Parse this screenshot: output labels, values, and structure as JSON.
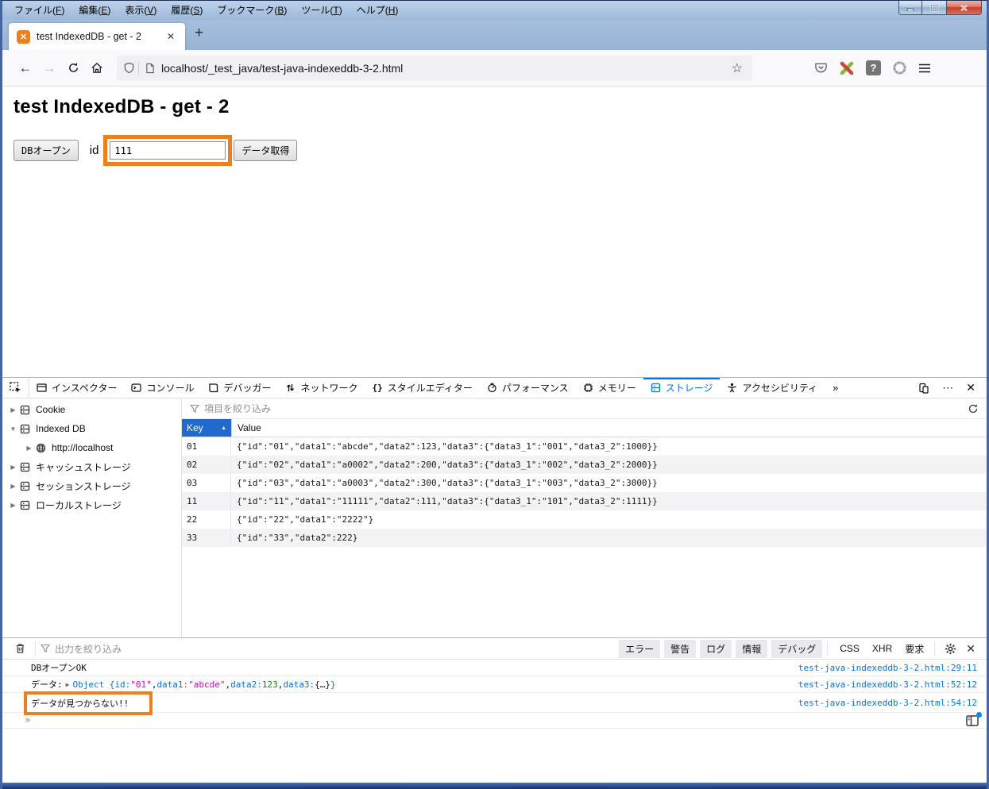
{
  "window": {
    "menu": [
      "ファイル(F)",
      "編集(E)",
      "表示(V)",
      "履歴(S)",
      "ブックマーク(B)",
      "ツール(T)",
      "ヘルプ(H)"
    ],
    "controls": [
      "minimize",
      "maximize",
      "close"
    ]
  },
  "tab_bar": {
    "active_tab_title": "test IndexedDB - get - 2",
    "favicon": "xampp-icon",
    "new_tab_label": "+"
  },
  "nav": {
    "url": "localhost/_test_java/test-java-indexeddb-3-2.html",
    "icons": [
      "back-icon",
      "forward-icon",
      "reload-icon",
      "home-icon",
      "shield-icon",
      "page-icon",
      "star-icon",
      "pocket-icon",
      "extension-x-icon",
      "question-extension-icon",
      "ring-icon",
      "menu-icon"
    ]
  },
  "page": {
    "heading": "test IndexedDB - get - 2",
    "db_open_button": "DBオープン",
    "id_label": "id",
    "id_value": "111",
    "get_button": "データ取得"
  },
  "devtools": {
    "tabs": [
      {
        "id": "inspector",
        "icon": "inspector-icon",
        "label": "インスペクター",
        "active": false
      },
      {
        "id": "console",
        "icon": "console-icon",
        "label": "コンソール",
        "active": false
      },
      {
        "id": "debugger",
        "icon": "debugger-icon",
        "label": "デバッガー",
        "active": false
      },
      {
        "id": "network",
        "icon": "network-icon",
        "label": "ネットワーク",
        "active": false
      },
      {
        "id": "styleeditor",
        "icon": "braces-icon",
        "label": "スタイルエディター",
        "active": false
      },
      {
        "id": "performance",
        "icon": "performance-icon",
        "label": "パフォーマンス",
        "active": false
      },
      {
        "id": "memory",
        "icon": "memory-icon",
        "label": "メモリー",
        "active": false
      },
      {
        "id": "storage",
        "icon": "storage-icon",
        "label": "ストレージ",
        "active": true
      },
      {
        "id": "accessibility",
        "icon": "accessibility-icon",
        "label": "アクセシビリティ",
        "active": false
      }
    ],
    "more_label": "»",
    "right_icons": [
      "responsive-design-icon",
      "meatball-menu-icon",
      "close-icon"
    ]
  },
  "storage": {
    "sidebar": [
      {
        "label": "Cookie",
        "twisty": "collapsed",
        "icon": "storage-icon",
        "level": 0
      },
      {
        "label": "Indexed DB",
        "twisty": "expanded",
        "icon": "storage-icon",
        "level": 0
      },
      {
        "label": "http://localhost",
        "twisty": "collapsed",
        "icon": "globe-icon",
        "level": 1
      },
      {
        "label": "キャッシュストレージ",
        "twisty": "collapsed",
        "icon": "storage-icon",
        "level": 0
      },
      {
        "label": "セッションストレージ",
        "twisty": "collapsed",
        "icon": "storage-icon",
        "level": 0
      },
      {
        "label": "ローカルストレージ",
        "twisty": "collapsed",
        "icon": "storage-icon",
        "level": 0
      }
    ],
    "filter_placeholder": "項目を絞り込み",
    "refresh_icon": "refresh-icon",
    "table": {
      "columns": [
        "Key",
        "Value"
      ],
      "sort": {
        "column": "Key",
        "direction": "asc"
      },
      "rows": [
        {
          "key": "01",
          "value": "{\"id\":\"01\",\"data1\":\"abcde\",\"data2\":123,\"data3\":{\"data3_1\":\"001\",\"data3_2\":1000}}"
        },
        {
          "key": "02",
          "value": "{\"id\":\"02\",\"data1\":\"a0002\",\"data2\":200,\"data3\":{\"data3_1\":\"002\",\"data3_2\":2000}}"
        },
        {
          "key": "03",
          "value": "{\"id\":\"03\",\"data1\":\"a0003\",\"data2\":300,\"data3\":{\"data3_1\":\"003\",\"data3_2\":3000}}"
        },
        {
          "key": "11",
          "value": "{\"id\":\"11\",\"data1\":\"11111\",\"data2\":111,\"data3\":{\"data3_1\":\"101\",\"data3_2\":1111}}"
        },
        {
          "key": "22",
          "value": "{\"id\":\"22\",\"data1\":\"2222\"}"
        },
        {
          "key": "33",
          "value": "{\"id\":\"33\",\"data2\":222}"
        }
      ]
    }
  },
  "console": {
    "filter_placeholder": "出力を絞り込み",
    "filter_chips": [
      "エラー",
      "警告",
      "ログ",
      "情報",
      "デバッグ"
    ],
    "filter_links": [
      "CSS",
      "XHR",
      "要求"
    ],
    "toolbar_icons": [
      "trash-icon",
      "funnel-icon",
      "gear-icon",
      "close-icon"
    ],
    "messages": [
      {
        "text": "DBオープンOK",
        "source": "test-java-indexeddb-3-2.html:29:11",
        "annotated": false
      },
      {
        "parts": [
          {
            "t": "データ: ",
            "k": "plain"
          },
          {
            "t": "▶",
            "k": "caret"
          },
          {
            "t": "Object { ",
            "k": "obj"
          },
          {
            "t": "id: ",
            "k": "prop"
          },
          {
            "t": "\"01\"",
            "k": "str"
          },
          {
            "t": ", ",
            "k": "plain"
          },
          {
            "t": "data1: ",
            "k": "prop"
          },
          {
            "t": "\"abcde\"",
            "k": "str"
          },
          {
            "t": ", ",
            "k": "plain"
          },
          {
            "t": "data2: ",
            "k": "prop"
          },
          {
            "t": "123",
            "k": "num"
          },
          {
            "t": ", ",
            "k": "plain"
          },
          {
            "t": "data3: ",
            "k": "prop"
          },
          {
            "t": "{…} ",
            "k": "plain"
          },
          {
            "t": "}",
            "k": "obj"
          }
        ],
        "source": "test-java-indexeddb-3-2.html:52:12",
        "annotated": false
      },
      {
        "text": "データが見つからない!!",
        "source": "test-java-indexeddb-3-2.html:54:12",
        "annotated": true
      }
    ],
    "prompt": "»",
    "toggle_icon": "sidebar-toggle-icon"
  },
  "colors": {
    "annotation_orange": "#ee7f1e",
    "accent_blue": "#0074e8",
    "key_header_blue": "#2069cf",
    "string_magenta": "#dd00a9",
    "number_green": "#058b00",
    "titlebar_blue": "#9db8da",
    "close_button_red": "#c53d2c"
  }
}
